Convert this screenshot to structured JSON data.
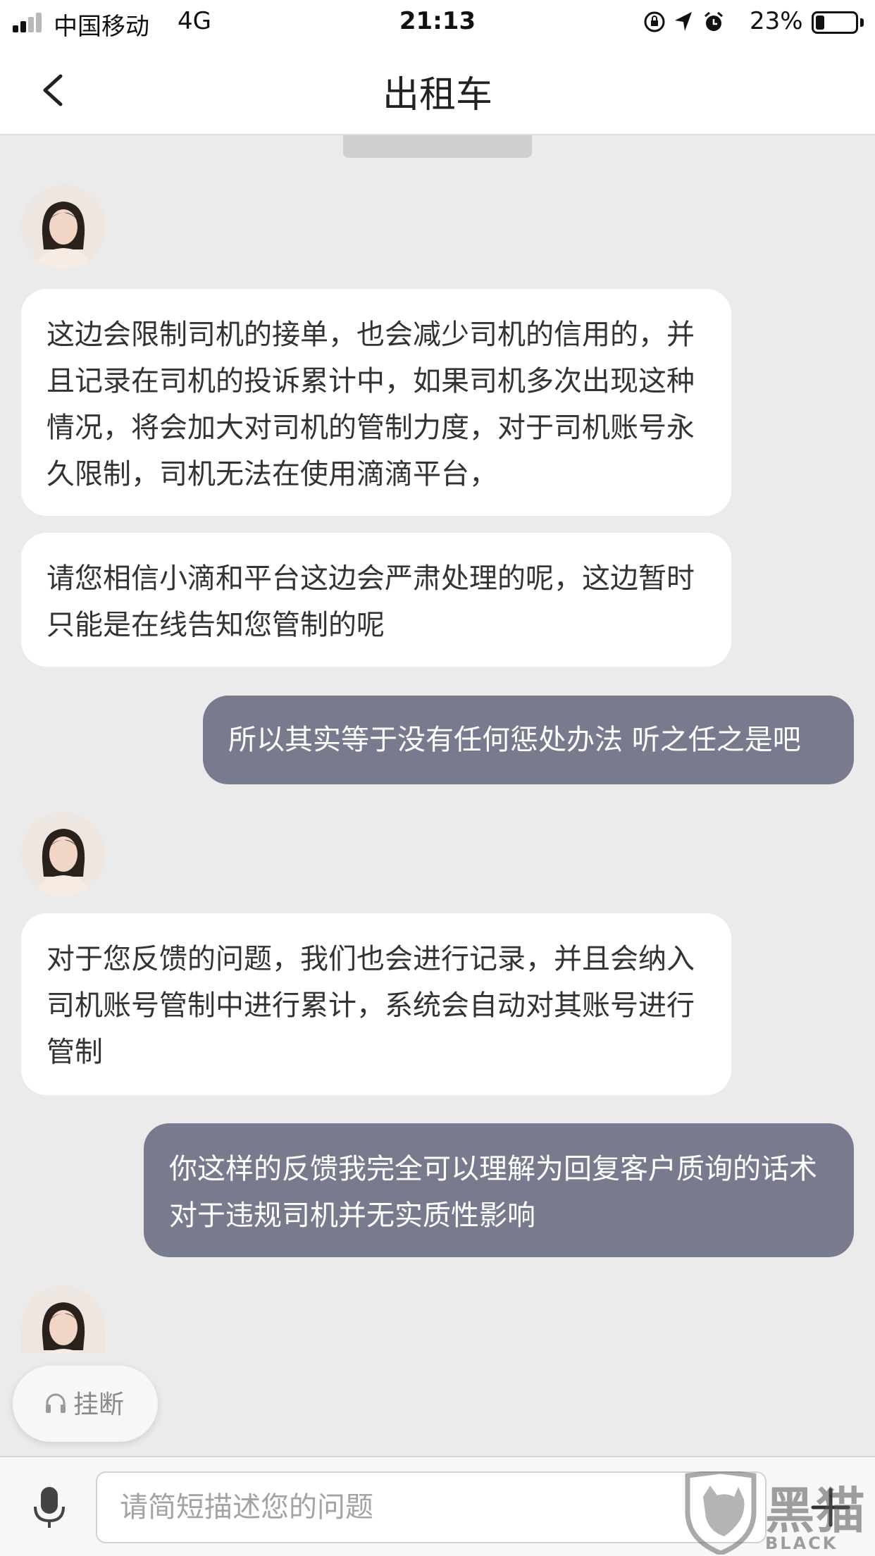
{
  "status_bar": {
    "carrier": "中国移动",
    "network": "4G",
    "time": "21:13",
    "battery_percent": "23%",
    "battery_level": 0.23,
    "signal_bars": 2
  },
  "header": {
    "title": "出租车"
  },
  "timestamp_pill": "",
  "messages": [
    {
      "side": "in",
      "text": "这边会限制司机的接单，也会减少司机的信用的，并且记录在司机的投诉累计中，如果司机多次出现这种情况，将会加大对司机的管制力度，对于司机账号永久限制，司机无法在使用滴滴平台，"
    },
    {
      "side": "in",
      "text": "请您相信小滴和平台这边会严肃处理的呢，这边暂时只能是在线告知您管制的呢"
    },
    {
      "side": "out",
      "text": "所以其实等于没有任何惩处办法 听之任之是吧"
    },
    {
      "side": "in",
      "text": "对于您反馈的问题，我们也会进行记录，并且会纳入司机账号管制中进行累计，系统会自动对其账号进行管制"
    },
    {
      "side": "out",
      "text": "你这样的反馈我完全可以理解为回复客户质询的话术 对于违规司机并无实质性影响"
    }
  ],
  "hangup": {
    "label": "挂断",
    "icon": "headset-icon"
  },
  "input": {
    "placeholder": "请简短描述您的问题",
    "value": ""
  },
  "icons": {
    "back": "chevron-left-icon",
    "mic": "microphone-icon",
    "plus": "plus-icon"
  },
  "watermark": {
    "text": "黑猫",
    "sub": "BLACK CAT"
  },
  "colors": {
    "background": "#ebebeb",
    "incoming_bubble": "#ffffff",
    "outgoing_bubble": "#777b8d",
    "header": "#ffffff"
  }
}
